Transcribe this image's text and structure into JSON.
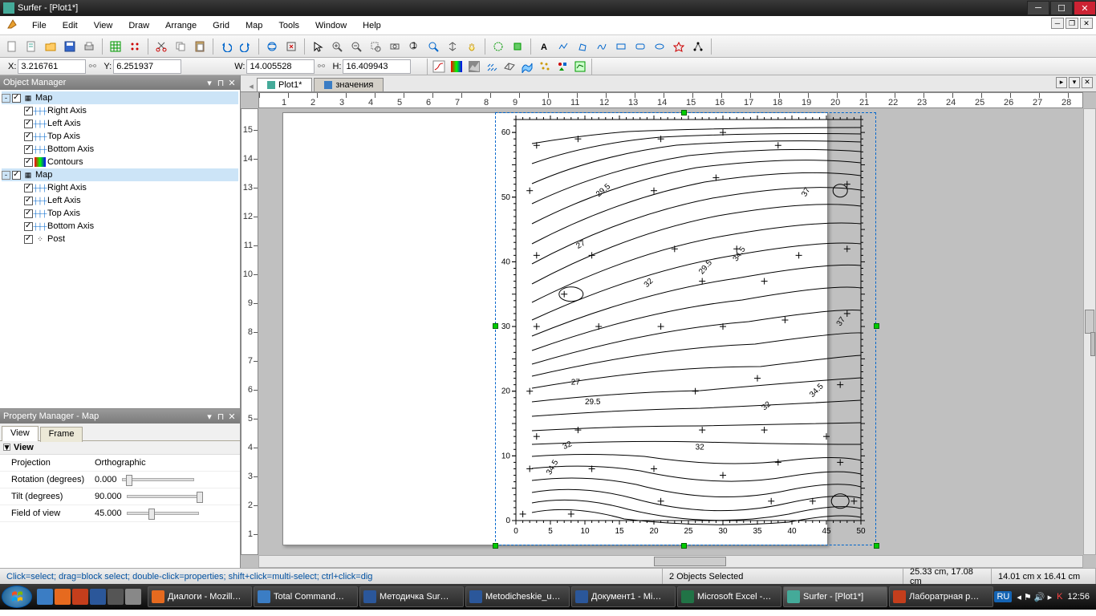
{
  "title": "Surfer - [Plot1*]",
  "menu": [
    "File",
    "Edit",
    "View",
    "Draw",
    "Arrange",
    "Grid",
    "Map",
    "Tools",
    "Window",
    "Help"
  ],
  "coords": {
    "x": "3.216761",
    "y": "6.251937",
    "w": "14.005528",
    "h": "16.409943"
  },
  "objmgr_title": "Object Manager",
  "tree1": {
    "root": "Map",
    "children": [
      "Right Axis",
      "Left Axis",
      "Top Axis",
      "Bottom Axis",
      "Contours"
    ]
  },
  "tree2": {
    "root": "Map",
    "children": [
      "Right Axis",
      "Left Axis",
      "Top Axis",
      "Bottom Axis",
      "Post"
    ]
  },
  "propmgr_title": "Property Manager - Map",
  "prop_tabs": [
    "View",
    "Frame"
  ],
  "prop_cat": "View",
  "props": [
    {
      "name": "Projection",
      "value": "Orthographic",
      "slider": null
    },
    {
      "name": "Rotation (degrees)",
      "value": "0.000",
      "slider": 5
    },
    {
      "name": "Tilt (degrees)",
      "value": "90.000",
      "slider": 98
    },
    {
      "name": "Field of view",
      "value": "45.000",
      "slider": 30
    }
  ],
  "doc_tabs": [
    "Plot1*",
    "значения"
  ],
  "status": {
    "hint": "Click=select; drag=block select; double-click=properties; shift+click=multi-select; ctrl+click=dig",
    "sel": "2 Objects Selected",
    "pos": "25.33 cm, 17.08 cm",
    "size": "14.01 cm x 16.41 cm"
  },
  "taskbar": [
    {
      "label": "Диалоги - Mozill…",
      "color": "#e66a1f"
    },
    {
      "label": "Total Command…",
      "color": "#3b7dc4"
    },
    {
      "label": "Методичка Sur…",
      "color": "#2b579a"
    },
    {
      "label": "Metodicheskie_u…",
      "color": "#2b579a"
    },
    {
      "label": "Документ1 - Mi…",
      "color": "#2b579a"
    },
    {
      "label": "Microsoft Excel -…",
      "color": "#217346"
    },
    {
      "label": "Surfer - [Plot1*]",
      "color": "#44aa99",
      "active": true
    },
    {
      "label": "Лаборатрная р…",
      "color": "#c43e1c"
    }
  ],
  "tray": {
    "lang": "RU",
    "time": "12:56"
  },
  "chart_data": {
    "type": "contour",
    "xlim": [
      0,
      50
    ],
    "ylim": [
      0,
      62
    ],
    "x_ticks": [
      0,
      5,
      10,
      15,
      20,
      25,
      30,
      35,
      40,
      45,
      50
    ],
    "y_ticks": [
      0,
      10,
      20,
      30,
      40,
      50,
      60
    ],
    "contour_labels": [
      27,
      29.5,
      32,
      34.5,
      37
    ],
    "post_points": [
      [
        1,
        1
      ],
      [
        8,
        1
      ],
      [
        21,
        3
      ],
      [
        37,
        3
      ],
      [
        43,
        3
      ],
      [
        49,
        3
      ],
      [
        2,
        8
      ],
      [
        11,
        8
      ],
      [
        20,
        8
      ],
      [
        30,
        7
      ],
      [
        38,
        9
      ],
      [
        47,
        9
      ],
      [
        3,
        13
      ],
      [
        9,
        14
      ],
      [
        27,
        14
      ],
      [
        36,
        14
      ],
      [
        45,
        13
      ],
      [
        2,
        20
      ],
      [
        26,
        20
      ],
      [
        35,
        22
      ],
      [
        47,
        21
      ],
      [
        3,
        30
      ],
      [
        12,
        30
      ],
      [
        21,
        30
      ],
      [
        30,
        30
      ],
      [
        39,
        31
      ],
      [
        48,
        32
      ],
      [
        7,
        35
      ],
      [
        27,
        37
      ],
      [
        36,
        37
      ],
      [
        3,
        41
      ],
      [
        11,
        41
      ],
      [
        23,
        42
      ],
      [
        32,
        42
      ],
      [
        41,
        41
      ],
      [
        48,
        42
      ],
      [
        2,
        51
      ],
      [
        20,
        51
      ],
      [
        29,
        53
      ],
      [
        48,
        52
      ],
      [
        3,
        58
      ],
      [
        9,
        59
      ],
      [
        21,
        59
      ],
      [
        30,
        60
      ],
      [
        38,
        58
      ]
    ]
  }
}
